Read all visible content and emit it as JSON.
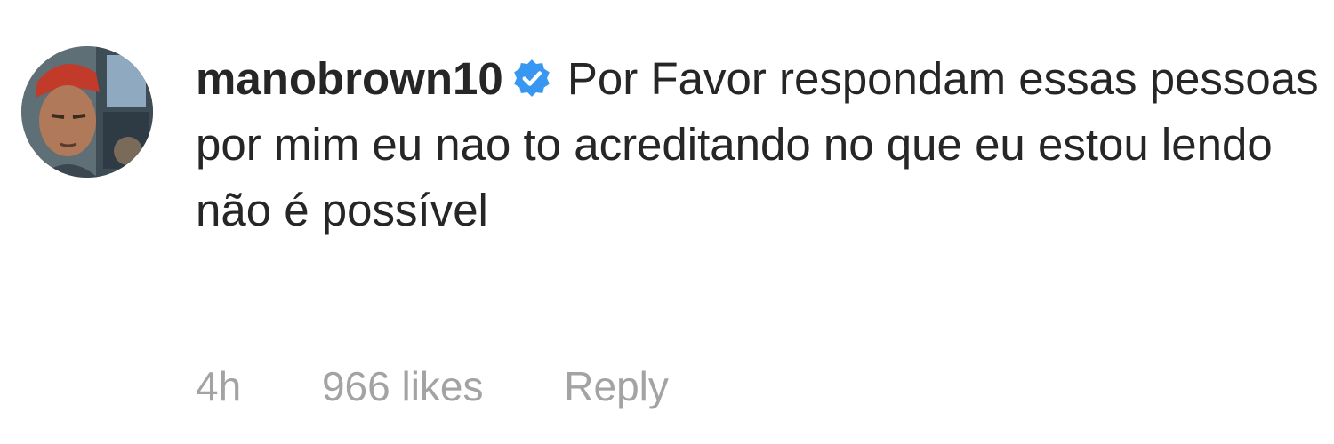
{
  "comment": {
    "username": "manobrown10",
    "verified_icon": "verified-badge-icon",
    "text": "Por Favor respondam essas pessoas por mim eu nao to acreditando no que eu estou lendo não é possível",
    "avatar_icon": "profile-avatar"
  },
  "meta": {
    "timestamp": "4h",
    "likes": "966 likes",
    "reply_label": "Reply"
  },
  "colors": {
    "text": "#262626",
    "meta": "#a3a3a3",
    "verified": "#3897f0"
  }
}
